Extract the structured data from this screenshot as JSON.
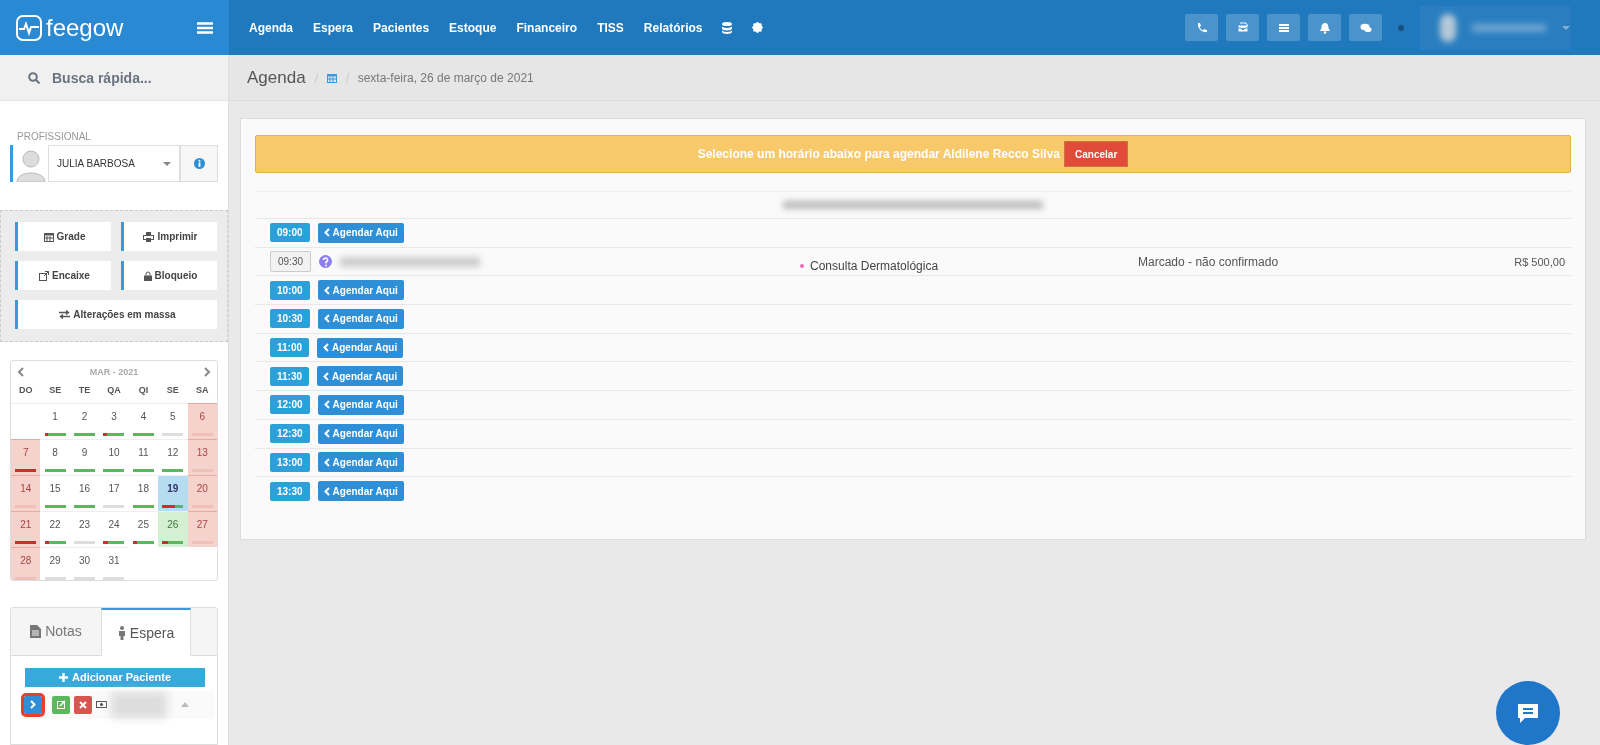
{
  "header": {
    "logo": "feegow",
    "nav": [
      {
        "label": "Agenda"
      },
      {
        "label": "Espera"
      },
      {
        "label": "Pacientes"
      },
      {
        "label": "Estoque"
      },
      {
        "label": "Financeiro"
      },
      {
        "label": "TISS"
      },
      {
        "label": "Relatórios"
      }
    ]
  },
  "sidebar": {
    "search": {
      "placeholder": "Busca rápida..."
    },
    "professional": {
      "label": "PROFISSIONAL",
      "value": "JULIA BARBOSA"
    },
    "actions": [
      {
        "label": "Grade",
        "kind": "calendar"
      },
      {
        "label": "Imprimir",
        "kind": "print"
      },
      {
        "label": "Encaixe",
        "kind": "external"
      },
      {
        "label": "Bloqueio",
        "kind": "lock"
      },
      {
        "label": "Alterações em massa",
        "kind": "swap"
      }
    ],
    "calendar": {
      "title": "MAR - 2021",
      "weekdays": [
        "DO",
        "SE",
        "TE",
        "QA",
        "QI",
        "SE",
        "SA"
      ],
      "weeks": [
        [
          {
            "day": "1",
            "closed": false,
            "today": false,
            "selected": false,
            "bar": [
              {
                "color": "#c9302c",
                "level": 0.15
              },
              {
                "color": "#5cb85c",
                "level": 0.85
              }
            ]
          },
          {
            "day": "2",
            "closed": false,
            "today": false,
            "selected": false,
            "bar": [
              {
                "color": "#5cb85c",
                "level": 1
              }
            ]
          },
          {
            "day": "3",
            "closed": false,
            "today": false,
            "selected": false,
            "bar": [
              {
                "color": "#c9302c",
                "level": 0.15
              },
              {
                "color": "#5cb85c",
                "level": 0.85
              }
            ]
          },
          {
            "day": "4",
            "closed": false,
            "today": false,
            "selected": false,
            "bar": [
              {
                "color": "#5cb85c",
                "level": 1
              }
            ]
          },
          {
            "day": "5",
            "closed": false,
            "today": false,
            "selected": false,
            "bar": [
              {
                "color": "#dddddd",
                "level": 1
              }
            ]
          },
          {
            "day": "6",
            "closed": true,
            "today": false,
            "selected": false,
            "bar": [
              {
                "color": "#eec0b8",
                "level": 1
              }
            ]
          }
        ],
        [
          {
            "day": "7",
            "closed": true,
            "today": false,
            "selected": false,
            "bar": [
              {
                "color": "#c9302c",
                "level": 1
              }
            ]
          },
          {
            "day": "8",
            "closed": false,
            "today": false,
            "selected": false,
            "bar": [
              {
                "color": "#5cb85c",
                "level": 1
              }
            ]
          },
          {
            "day": "9",
            "closed": false,
            "today": false,
            "selected": false,
            "bar": [
              {
                "color": "#5cb85c",
                "level": 1
              }
            ]
          },
          {
            "day": "10",
            "closed": false,
            "today": false,
            "selected": false,
            "bar": [
              {
                "color": "#5cb85c",
                "level": 1
              }
            ]
          },
          {
            "day": "11",
            "closed": false,
            "today": false,
            "selected": false,
            "bar": [
              {
                "color": "#5cb85c",
                "level": 1
              }
            ]
          },
          {
            "day": "12",
            "closed": false,
            "today": false,
            "selected": false,
            "bar": [
              {
                "color": "#5cb85c",
                "level": 1
              }
            ]
          },
          {
            "day": "13",
            "closed": true,
            "today": false,
            "selected": false,
            "bar": [
              {
                "color": "#eec0b8",
                "level": 1
              }
            ]
          }
        ],
        [
          {
            "day": "14",
            "closed": true,
            "today": false,
            "selected": false,
            "bar": [
              {
                "color": "#eec0b8",
                "level": 1
              }
            ]
          },
          {
            "day": "15",
            "closed": false,
            "today": false,
            "selected": false,
            "bar": [
              {
                "color": "#5cb85c",
                "level": 1
              }
            ]
          },
          {
            "day": "16",
            "closed": false,
            "today": false,
            "selected": false,
            "bar": [
              {
                "color": "#5cb85c",
                "level": 1
              }
            ]
          },
          {
            "day": "17",
            "closed": false,
            "today": false,
            "selected": false,
            "bar": [
              {
                "color": "#dddddd",
                "level": 1
              }
            ]
          },
          {
            "day": "18",
            "closed": false,
            "today": false,
            "selected": false,
            "bar": [
              {
                "color": "#5cb85c",
                "level": 1
              }
            ]
          },
          {
            "day": "19",
            "closed": false,
            "today": true,
            "selected": false,
            "bar": [
              {
                "color": "#c9302c",
                "level": 0.6
              },
              {
                "color": "#5cb85c",
                "level": 0.4
              }
            ]
          },
          {
            "day": "20",
            "closed": true,
            "today": false,
            "selected": false,
            "bar": [
              {
                "color": "#eec0b8",
                "level": 1
              }
            ]
          }
        ],
        [
          {
            "day": "21",
            "closed": true,
            "today": false,
            "selected": false,
            "bar": [
              {
                "color": "#c9302c",
                "level": 1
              }
            ]
          },
          {
            "day": "22",
            "closed": false,
            "today": false,
            "selected": false,
            "bar": [
              {
                "color": "#c9302c",
                "level": 0.2
              },
              {
                "color": "#5cb85c",
                "level": 0.8
              }
            ]
          },
          {
            "day": "23",
            "closed": false,
            "today": false,
            "selected": false,
            "bar": [
              {
                "color": "#dddddd",
                "level": 1
              }
            ]
          },
          {
            "day": "24",
            "closed": false,
            "today": false,
            "selected": false,
            "bar": [
              {
                "color": "#c9302c",
                "level": 0.2
              },
              {
                "color": "#5cb85c",
                "level": 0.8
              }
            ]
          },
          {
            "day": "25",
            "closed": false,
            "today": false,
            "selected": false,
            "bar": [
              {
                "color": "#c9302c",
                "level": 0.2
              },
              {
                "color": "#5cb85c",
                "level": 0.8
              }
            ]
          },
          {
            "day": "26",
            "closed": false,
            "today": false,
            "selected": true,
            "bar": [
              {
                "color": "#c9302c",
                "level": 0.25
              },
              {
                "color": "#5cb85c",
                "level": 0.75
              }
            ]
          },
          {
            "day": "27",
            "closed": true,
            "today": false,
            "selected": false,
            "bar": [
              {
                "color": "#eec0b8",
                "level": 1
              }
            ]
          }
        ],
        [
          {
            "day": "28",
            "closed": true,
            "today": false,
            "selected": false,
            "bar": [
              {
                "color": "#eec0b8",
                "level": 1
              }
            ]
          },
          {
            "day": "29",
            "closed": false,
            "today": false,
            "selected": false,
            "bar": [
              {
                "color": "#dddddd",
                "level": 1
              }
            ]
          },
          {
            "day": "30",
            "closed": false,
            "today": false,
            "selected": false,
            "bar": [
              {
                "color": "#dddddd",
                "level": 1
              }
            ]
          },
          {
            "day": "31",
            "closed": false,
            "today": false,
            "selected": false,
            "bar": [
              {
                "color": "#dddddd",
                "level": 1
              }
            ]
          }
        ]
      ]
    },
    "tabs": [
      {
        "label": "Notas",
        "kind": "notes",
        "selected": false
      },
      {
        "label": "Espera",
        "kind": "person",
        "selected": true
      }
    ],
    "add_button": "Adicionar Paciente"
  },
  "main": {
    "breadcrumb": {
      "title": "Agenda",
      "date": "sexta-feira, 26 de março de 2021"
    },
    "alert": {
      "text": "Selecione um horário abaixo para agendar Aldilene Recco Silva",
      "button": "Cancelar"
    },
    "slots": [
      {
        "time": "09:00",
        "kind": "free",
        "action": "Agendar Aqui"
      },
      {
        "time": "09:30",
        "kind": "booked",
        "procedure": "Consulta Dermatológica",
        "status": "Marcado - não confirmado",
        "price": "R$ 500,00"
      },
      {
        "time": "10:00",
        "kind": "free",
        "action": "Agendar Aqui"
      },
      {
        "time": "10:30",
        "kind": "free",
        "action": "Agendar Aqui"
      },
      {
        "time": "11:00",
        "kind": "free",
        "action": "Agendar Aqui"
      },
      {
        "time": "11:30",
        "kind": "free",
        "action": "Agendar Aqui"
      },
      {
        "time": "12:00",
        "kind": "free",
        "action": "Agendar Aqui"
      },
      {
        "time": "12:30",
        "kind": "free",
        "action": "Agendar Aqui"
      },
      {
        "time": "13:00",
        "kind": "free",
        "action": "Agendar Aqui"
      },
      {
        "time": "13:30",
        "kind": "free",
        "action": "Agendar Aqui"
      }
    ]
  }
}
